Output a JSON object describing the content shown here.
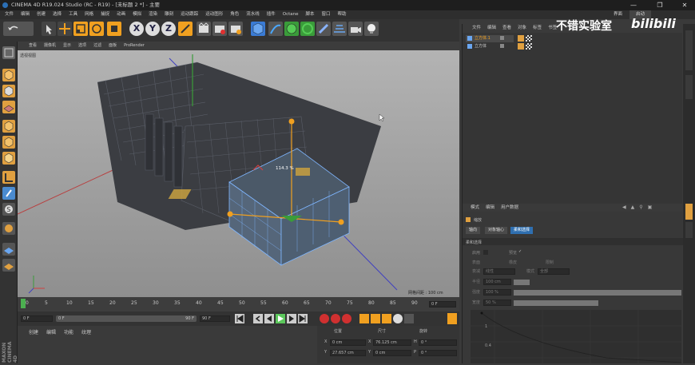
{
  "window": {
    "title": "CINEMA 4D R19.024 Studio (RC - R19) - [未标题 2 *] - 主要",
    "minimize": "—",
    "restore": "❐",
    "close": "✕"
  },
  "menu": [
    "文件",
    "编辑",
    "创建",
    "选择",
    "工具",
    "网格",
    "捕捉",
    "动画",
    "模拟",
    "渲染",
    "雕刻",
    "运动跟踪",
    "运动图形",
    "角色",
    "流水线",
    "插件",
    "Octane",
    "脚本",
    "窗口",
    "帮助"
  ],
  "layout_label": "界面",
  "layout_value": "启动",
  "toolbar": {
    "x_label": "X",
    "y_label": "Y",
    "z_label": "Z"
  },
  "viewport": {
    "menu": [
      "查看",
      "摄像机",
      "显示",
      "选项",
      "过滤",
      "面板",
      "ProRender"
    ],
    "camera_label": "透视视图",
    "scale_readout": "114.3 %",
    "grid_spacing_label": "网格间距 : 100 cm"
  },
  "timeline": {
    "ticks": [
      "0",
      "5",
      "10",
      "15",
      "20",
      "25",
      "30",
      "35",
      "40",
      "45",
      "50",
      "55",
      "60",
      "65",
      "70",
      "75",
      "80",
      "85",
      "90"
    ],
    "current_frame": "0 F"
  },
  "playbar": {
    "start": "0 F",
    "end": "90 F",
    "range_end": "90 F",
    "scrub_label": "0 F"
  },
  "materials": {
    "menu": [
      "创建",
      "编辑",
      "功能",
      "纹理"
    ]
  },
  "coords": {
    "headers": [
      "位置",
      "尺寸",
      "旋转"
    ],
    "rows": [
      {
        "axis": "X",
        "pos": "0 cm",
        "size": "76.125 cm",
        "rot_axis": "H",
        "rot": "0 °"
      },
      {
        "axis": "Y",
        "pos": "27.657 cm",
        "size": "0 cm",
        "rot_axis": "P",
        "rot": "0 °"
      }
    ]
  },
  "objects": {
    "menu": [
      "文件",
      "编辑",
      "查看",
      "对象",
      "标签",
      "书签"
    ],
    "items": [
      {
        "name": "立方体.1",
        "selected": true
      },
      {
        "name": "立方体",
        "selected": false
      }
    ]
  },
  "attributes": {
    "menu": [
      "模式",
      "编辑",
      "用户数据"
    ],
    "object_title": "缩放",
    "tabs": [
      "轴向",
      "对象轴心",
      "柔和选择"
    ],
    "active_tab": "柔和选择",
    "section": "柔和选择",
    "fields": [
      {
        "label": "启用",
        "value": ""
      },
      {
        "label": "预览",
        "value": "✓"
      },
      {
        "label": "表面",
        "value": ""
      },
      {
        "label": "橡皮",
        "value": ""
      },
      {
        "label": "限制",
        "value": ""
      },
      {
        "label": "衰减",
        "value": "线性"
      },
      {
        "label": "模式",
        "value": "全部"
      },
      {
        "label": "半径",
        "value": "100 cm"
      },
      {
        "label": "强度",
        "value": "100 %"
      },
      {
        "label": "宽度",
        "value": "50 %"
      }
    ],
    "graph_labels": [
      "1",
      "0.4"
    ]
  },
  "watermark": {
    "text": "不错实验室",
    "brand": "bilibili"
  },
  "side_label": "MAXON CINEMA 4D"
}
